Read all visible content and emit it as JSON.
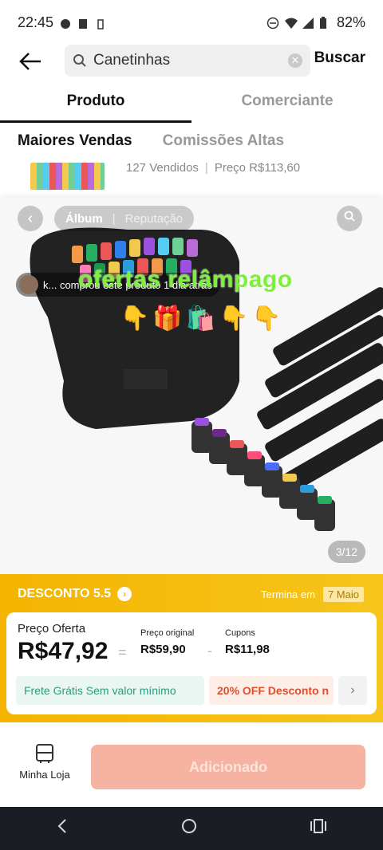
{
  "status_bar": {
    "time": "22:45",
    "battery": "82%"
  },
  "search": {
    "query": "Canetinhas",
    "submit_label": "Buscar"
  },
  "tabs": [
    {
      "label": "Produto"
    },
    {
      "label": "Comerciante"
    }
  ],
  "subtabs": [
    {
      "label": "Maiores Vendas"
    },
    {
      "label": "Comissões Altas"
    }
  ],
  "result": {
    "sold": "127 Vendidos",
    "price": "Preço R$113,60"
  },
  "image_view": {
    "tab_album": "Álbum",
    "tab_reputation": "Reputação",
    "buyer_text": "k... comprou este produto 1 dia atrás",
    "promo_text": "ofertas relâmpago",
    "emoji": "👇🎁🛍️👇👇",
    "page_counter": "3/12"
  },
  "discount": {
    "title": "DESCONTO 5.5",
    "ends_label": "Termina em",
    "ends_date": "7 Maio"
  },
  "price": {
    "offer_label": "Preço Oferta",
    "offer_value": "R$47,92",
    "original_label": "Preço original",
    "original_value": "R$59,90",
    "coupon_label": "Cupons",
    "coupon_value": "R$11,98",
    "chip_free": "Frete Grátis Sem valor mínimo",
    "chip_off": "20% OFF Desconto n"
  },
  "bottom": {
    "store_label": "Minha Loja",
    "add_label": "Adicionado"
  },
  "colors": {
    "accent": "#f4b400",
    "add_button": "#f7b3a1",
    "promo_green": "#7cf03a"
  }
}
